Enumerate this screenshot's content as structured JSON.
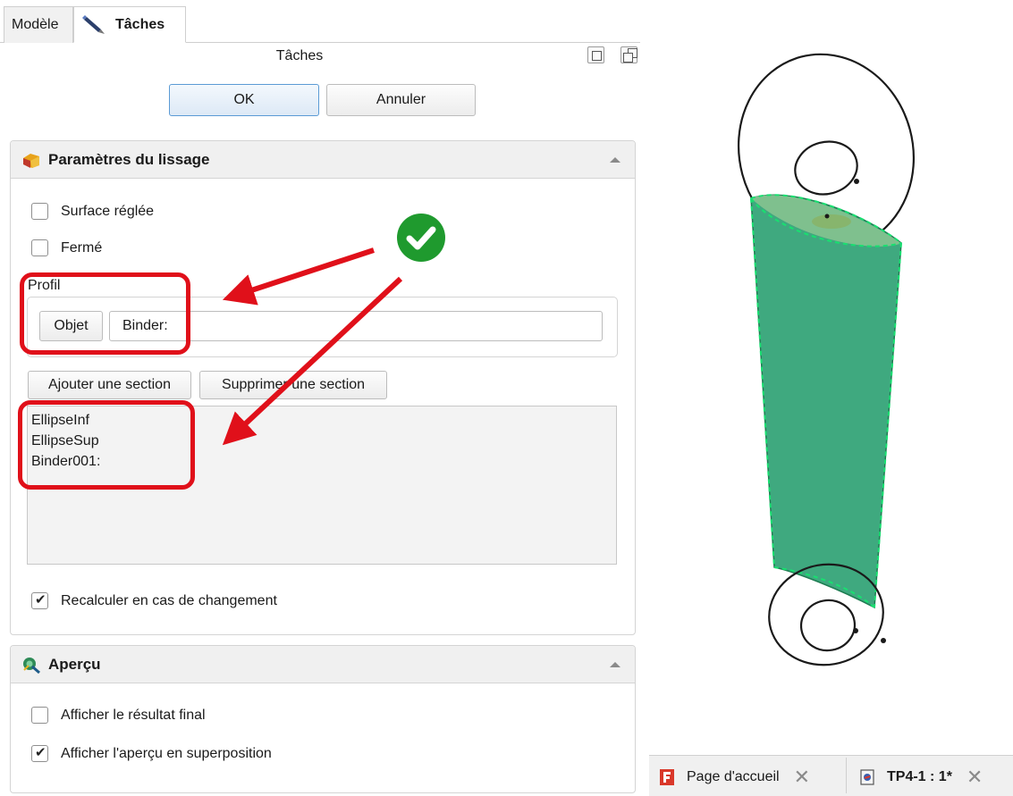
{
  "tabs": {
    "modele": "Modèle",
    "taches": "Tâches"
  },
  "task_panel": {
    "title": "Tâches",
    "ok_label": "OK",
    "cancel_label": "Annuler"
  },
  "loft_section": {
    "title": "Paramètres du lissage",
    "ruled_surface": {
      "label": "Surface réglée",
      "checked": false
    },
    "closed": {
      "label": "Fermé",
      "checked": false
    },
    "profile_label": "Profil",
    "object_button": "Objet",
    "profile_value": "Binder:",
    "add_section_button": "Ajouter une section",
    "remove_section_button": "Supprimer une section",
    "sections": [
      "EllipseInf",
      "EllipseSup",
      "Binder001:"
    ],
    "recompute": {
      "label": "Recalculer en cas de changement",
      "checked": true
    }
  },
  "preview_section": {
    "title": "Aperçu",
    "show_final": {
      "label": "Afficher le résultat final",
      "checked": false
    },
    "show_overlay": {
      "label": "Afficher l'aperçu en superposition",
      "checked": true
    }
  },
  "bottom_tabs": {
    "start_page": "Page d'accueil",
    "document": "TP4-1 : 1*"
  },
  "colors": {
    "annotation_red": "#e0101a",
    "check_green": "#1f9a2e",
    "loft_green": "#3fa97f",
    "ok_border": "#5b9bd5"
  },
  "icons": [
    "pencil-icon",
    "loft-icon",
    "appearance-icon",
    "check-circle-icon",
    "freecad-icon",
    "document-icon",
    "close-icon"
  ]
}
